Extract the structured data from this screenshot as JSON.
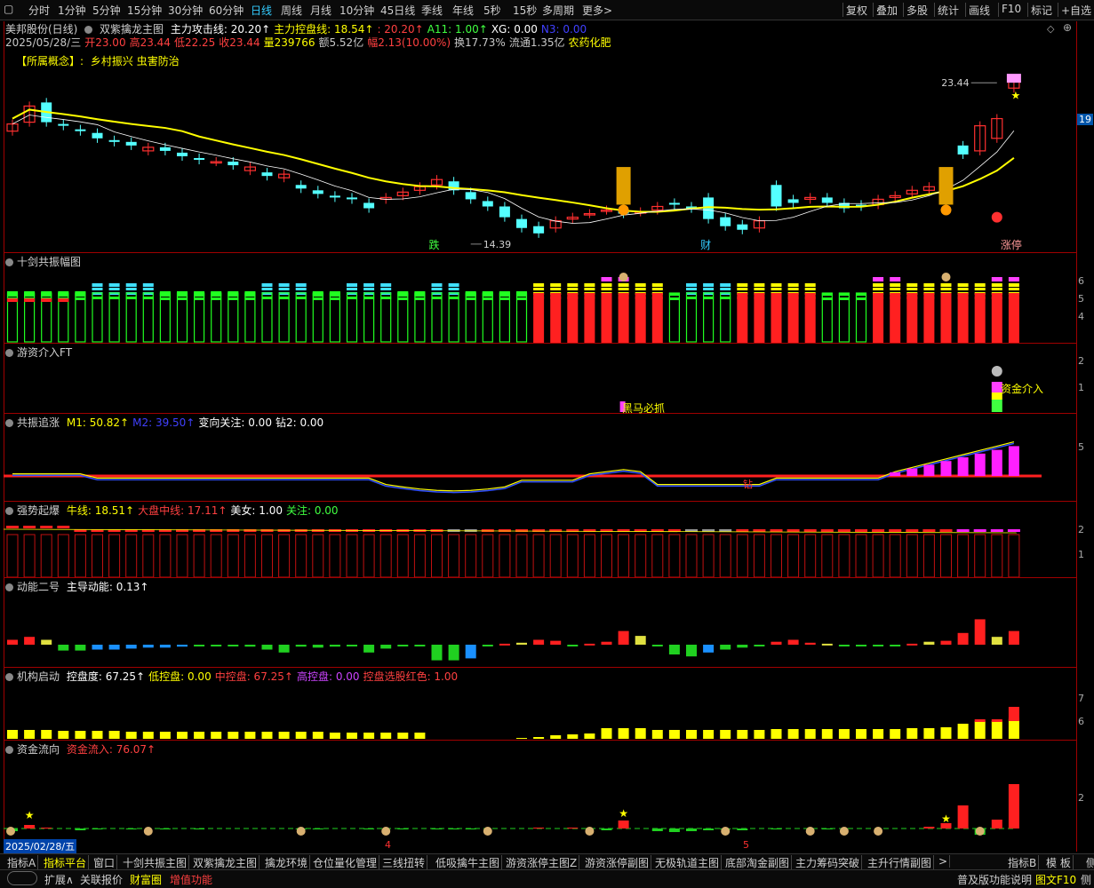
{
  "topbar": {
    "periods": [
      "分时",
      "1分钟",
      "5分钟",
      "15分钟",
      "30分钟",
      "60分钟",
      "日线",
      "周线",
      "月线",
      "10分钟",
      "45日线",
      "季线",
      "年线",
      "5秒",
      "15秒",
      "多周期",
      "更多>"
    ],
    "active_period": "日线",
    "right_buttons": [
      "复权",
      "叠加",
      "多股",
      "统计",
      "画线",
      "F10",
      "标记",
      "+自选"
    ]
  },
  "stock": {
    "title": "美邦股份(日线)",
    "indicator_name": "双紫擒龙主图",
    "ind_items": [
      {
        "text": "主力攻击线: 20.20↑",
        "color": "#ffffff"
      },
      {
        "text": "主力控盘线: 18.54↑",
        "color": "#ffff00"
      },
      {
        "text": ": 20.20↑",
        "color": "#ff4040"
      },
      {
        "text": "A11: 1.00↑",
        "color": "#40ff40"
      },
      {
        "text": "XG: 0.00",
        "color": "#ffffff"
      },
      {
        "text": "N3: 0.00",
        "color": "#4040ff"
      }
    ],
    "quote_items": [
      {
        "text": "2025/05/28/三",
        "color": "#c8c8c8"
      },
      {
        "text": "开23.00",
        "color": "#ff4040"
      },
      {
        "text": "高23.44",
        "color": "#ff4040"
      },
      {
        "text": "低22.25",
        "color": "#ff4040"
      },
      {
        "text": "收23.44",
        "color": "#ff4040"
      },
      {
        "text": "量239766",
        "color": "#ffff00"
      },
      {
        "text": "额5.52亿",
        "color": "#c8c8c8"
      },
      {
        "text": "幅2.13(10.00%)",
        "color": "#ff4040"
      },
      {
        "text": "换17.73%",
        "color": "#c8c8c8"
      },
      {
        "text": "流通1.35亿",
        "color": "#c8c8c8"
      },
      {
        "text": "农药化肥",
        "color": "#ffff00"
      }
    ],
    "concept_label": "【所属概念】:",
    "concepts": "乡村振兴 虫害防治",
    "price_high_label": "23.44",
    "price_low_label": "14.39",
    "axis_price": "19",
    "markers": {
      "die": "跌",
      "cai": "财",
      "zhangting": "涨停"
    }
  },
  "panels": {
    "p1": {
      "title": "十剑共振幅图"
    },
    "p2": {
      "title": "游资介入FT",
      "label_heima": "黑马必抓",
      "label_zijin": "资金介入"
    },
    "p3": {
      "title": "共振追涨",
      "items": [
        {
          "text": "M1: 50.82↑",
          "color": "#ffff00"
        },
        {
          "text": "M2: 39.50↑",
          "color": "#4040ff"
        },
        {
          "text": "变向关注: 0.00",
          "color": "#ffffff"
        },
        {
          "text": "钻2: 0.00",
          "color": "#ffffff"
        }
      ],
      "label_zuan": "钻"
    },
    "p4": {
      "title": "强势起爆",
      "items": [
        {
          "text": "牛线: 18.51↑",
          "color": "#ffff00"
        },
        {
          "text": "大盘中线: 17.11↑",
          "color": "#ff4040"
        },
        {
          "text": "美女: 1.00",
          "color": "#ffffff"
        },
        {
          "text": "关注: 0.00",
          "color": "#40ff40"
        }
      ]
    },
    "p5": {
      "title": "动能二号",
      "items": [
        {
          "text": "主导动能: 0.13↑",
          "color": "#ffffff"
        }
      ]
    },
    "p6": {
      "title": "机构启动",
      "items": [
        {
          "text": "控盘度: 67.25↑",
          "color": "#ffffff"
        },
        {
          "text": "低控盘: 0.00",
          "color": "#ffff00"
        },
        {
          "text": "中控盘: 67.25↑",
          "color": "#ff4040"
        },
        {
          "text": "高控盘: 0.00",
          "color": "#cc44ff"
        },
        {
          "text": "控盘选股红色: 1.00",
          "color": "#ff4040"
        }
      ]
    },
    "p7": {
      "title": "资金流向",
      "items": [
        {
          "text": "资金流入: 76.07↑",
          "color": "#ff4040"
        }
      ]
    }
  },
  "dates": {
    "start": "2025/02/28/五",
    "m4": "4",
    "m5": "5"
  },
  "tabs": [
    "指标A",
    "指标平台",
    "窗口",
    "十剑共振主图",
    "双紫擒龙主图",
    "擒龙环境",
    "仓位量化管理",
    "三线扭转",
    "低吸擒牛主图",
    "游资涨停主图Z",
    "游资涨停副图",
    "无极轨道主图",
    "底部淘金副图",
    "主力筹码突破",
    "主升行情副图",
    ">"
  ],
  "active_tab": "指标平台",
  "tabs_right": [
    "指标B",
    "模 板",
    "侧"
  ],
  "status": {
    "left": [
      {
        "text": "扩展∧",
        "color": "#d0d0d0"
      },
      {
        "text": "关联报价",
        "color": "#d0d0d0"
      },
      {
        "text": "财富圈",
        "color": "#ffff00"
      },
      {
        "text": "增值功能",
        "color": "#ff4040"
      }
    ],
    "right": [
      {
        "text": "普及版功能说明",
        "color": "#d0d0d0"
      },
      {
        "text": "图文F10",
        "color": "#ffff00"
      },
      {
        "text": "侧",
        "color": "#d0d0d0"
      }
    ]
  },
  "colors": {
    "up": "#ff3030",
    "down": "#54ffff",
    "ma_main": "#ffff00",
    "ma_white": "#ffffff",
    "border": "#a00000"
  }
}
